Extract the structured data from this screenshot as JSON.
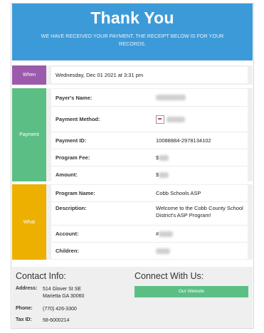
{
  "header": {
    "title": "Thank You",
    "subtitle": "WE HAVE RECEIVED YOUR PAYMENT. THE RECEIPT BELOW IS FOR YOUR RECORDS."
  },
  "colors": {
    "hero": "#3d9ad8",
    "when": "#9c5aac",
    "payment": "#5bbf85",
    "what": "#edb000",
    "website_button": "#5bbf85"
  },
  "when": {
    "label": "When",
    "value": "Wednesday, Dec 01 2021 at 3:31 pm"
  },
  "payment": {
    "label": "Payment",
    "rows": [
      {
        "key": "Payer's Name:",
        "value": ""
      },
      {
        "key": "Payment Method:",
        "value": ""
      },
      {
        "key": "Payment ID:",
        "value": "10088884-2978134102"
      },
      {
        "key": "Program Fee:",
        "value": "$"
      },
      {
        "key": "Amount:",
        "value": "$"
      }
    ]
  },
  "what": {
    "label": "What",
    "rows": [
      {
        "key": "Program Name:",
        "value": "Cobb Schools ASP"
      },
      {
        "key": "Description:",
        "value": "Welcome to the Cobb County School District's ASP Program!"
      },
      {
        "key": "Account:",
        "value": "#"
      },
      {
        "key": "Children:",
        "value": ""
      }
    ]
  },
  "contact": {
    "title": "Contact Info:",
    "address_label": "Address:",
    "address_line1": "514 Glover St SE",
    "address_line2": "Marietta GA 30060",
    "phone_label": "Phone:",
    "phone": "(770) 426-3300",
    "tax_label": "Tax ID:",
    "tax": "58-6000214"
  },
  "connect": {
    "title": "Connect With Us:",
    "website_label": "Our Website"
  }
}
